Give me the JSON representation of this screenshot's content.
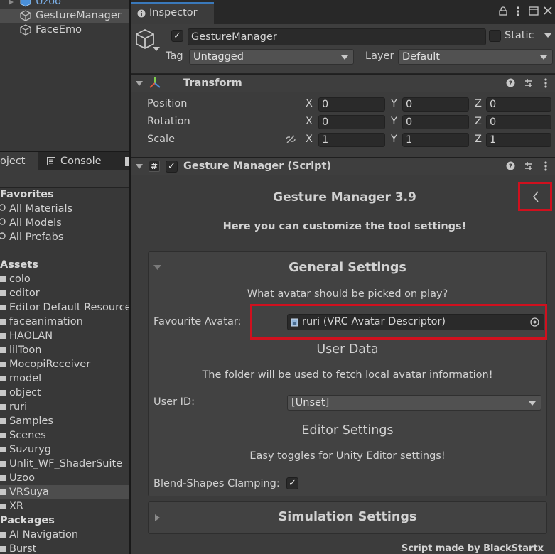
{
  "hierarchy": {
    "items": [
      {
        "label": "Uzoo"
      },
      {
        "label": "GestureManager",
        "selected": true
      },
      {
        "label": "FaceEmo"
      }
    ]
  },
  "bottom_tabs": {
    "project": "oject",
    "console": "Console"
  },
  "project": {
    "favorites_header": "Favorites",
    "favorites": [
      "All Materials",
      "All Models",
      "All Prefabs"
    ],
    "assets_header": "Assets",
    "assets": [
      "colo",
      "editor",
      "Editor Default Resource",
      "faceanimation",
      "HAOLAN",
      "lilToon",
      "MocopiReceiver",
      "model",
      "object",
      "ruri",
      "Samples",
      "Scenes",
      "Suzuryg",
      "Unlit_WF_ShaderSuite",
      "Uzoo",
      "VRSuya",
      "XR"
    ],
    "selected_asset": "VRSuya",
    "packages_header": "Packages",
    "packages": [
      "AI Navigation",
      "Burst"
    ]
  },
  "inspector": {
    "tab_label": "Inspector",
    "object_name": "GestureManager",
    "static_label": "Static",
    "tag_label": "Tag",
    "tag_value": "Untagged",
    "layer_label": "Layer",
    "layer_value": "Default"
  },
  "transform": {
    "title": "Transform",
    "rows": [
      {
        "label": "Position",
        "x": "0",
        "y": "0",
        "z": "0"
      },
      {
        "label": "Rotation",
        "x": "0",
        "y": "0",
        "z": "0"
      },
      {
        "label": "Scale",
        "x": "1",
        "y": "1",
        "z": "1"
      }
    ],
    "axis": {
      "x": "X",
      "y": "Y",
      "z": "Z"
    }
  },
  "gesture_manager": {
    "component_title": "Gesture Manager (Script)",
    "title": "Gesture Manager 3.9",
    "subtitle": "Here you can customize the tool settings!",
    "general_header": "General Settings",
    "general_question": "What avatar should be picked on play?",
    "favourite_label": "Favourite Avatar:",
    "favourite_value": "ruri (VRC Avatar Descriptor)",
    "user_data_header": "User Data",
    "user_data_desc": "The folder will be used to fetch local avatar information!",
    "user_id_label": "User ID:",
    "user_id_value": "[Unset]",
    "editor_header": "Editor Settings",
    "editor_desc": "Easy toggles for Unity Editor settings!",
    "blend_label": "Blend-Shapes Clamping:",
    "blend_checked": true,
    "simulation_header": "Simulation Settings",
    "footer": "Script made by BlackStartx"
  },
  "colors": {
    "highlight": "#d0101e",
    "accent": "#3a79bb"
  }
}
